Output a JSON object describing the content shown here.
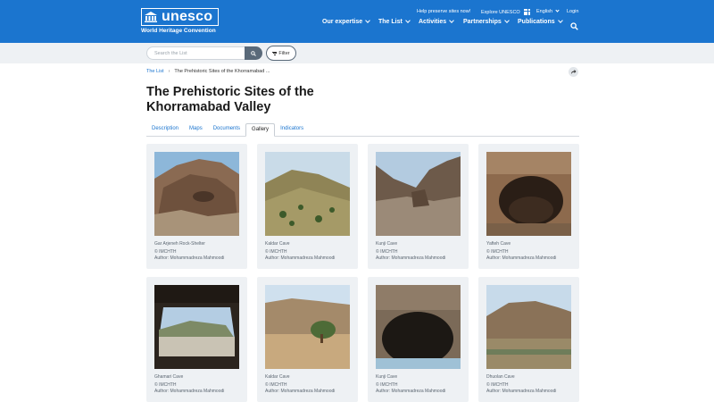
{
  "header": {
    "logo_text": "unesco",
    "logo_subtitle": "World Heritage Convention",
    "utility": {
      "help": "Help preserve sites now!",
      "explore": "Explore UNESCO",
      "language": "English",
      "login": "Login"
    },
    "nav": [
      "Our expertise",
      "The List",
      "Activities",
      "Partnerships",
      "Publications"
    ],
    "icons": {
      "search": "search-icon",
      "apps": "grid-icon"
    },
    "colors": {
      "brand": "#1b75cf"
    }
  },
  "search": {
    "placeholder": "Search the List",
    "filter_label": "Filter"
  },
  "breadcrumb": {
    "root": "The List",
    "current": "The Prehistoric Sites of the Khorramabad ..."
  },
  "page": {
    "title": "The Prehistoric Sites of the Khorramabad Valley"
  },
  "tabs": [
    {
      "label": "Description",
      "active": false
    },
    {
      "label": "Maps",
      "active": false
    },
    {
      "label": "Documents",
      "active": false
    },
    {
      "label": "Gallery",
      "active": true
    },
    {
      "label": "Indicators",
      "active": false
    }
  ],
  "gallery": [
    {
      "caption": "Gar Arjeneh Rock-Shelter",
      "copyright": "© IMCHTH",
      "author": "Author: Mohammadreza Mahmoodi"
    },
    {
      "caption": "Kaldar Cave",
      "copyright": "© IMCHTH",
      "author": "Author: Mohammadreza Mahmoodi"
    },
    {
      "caption": "Kunji Cave",
      "copyright": "© IMCHTH",
      "author": "Author: Mohammadreza Mahmoodi"
    },
    {
      "caption": "Yafteh Cave",
      "copyright": "© IMCHTH",
      "author": "Author: Mohammadreza Mahmoodi"
    },
    {
      "caption": "Ghamari Cave",
      "copyright": "© IMCHTH",
      "author": "Author: Mohammadreza Mahmoodi"
    },
    {
      "caption": "Kaldar Cave",
      "copyright": "© IMCHTH",
      "author": "Author: Mohammadreza Mahmoodi"
    },
    {
      "caption": "Kunji Cave",
      "copyright": "© IMCHTH",
      "author": "Author: Mohammadreza Mahmoodi"
    },
    {
      "caption": "Dhuolan Cave",
      "copyright": "© IMCHTH",
      "author": "Author: Mohammadreza Mahmoodi"
    }
  ]
}
